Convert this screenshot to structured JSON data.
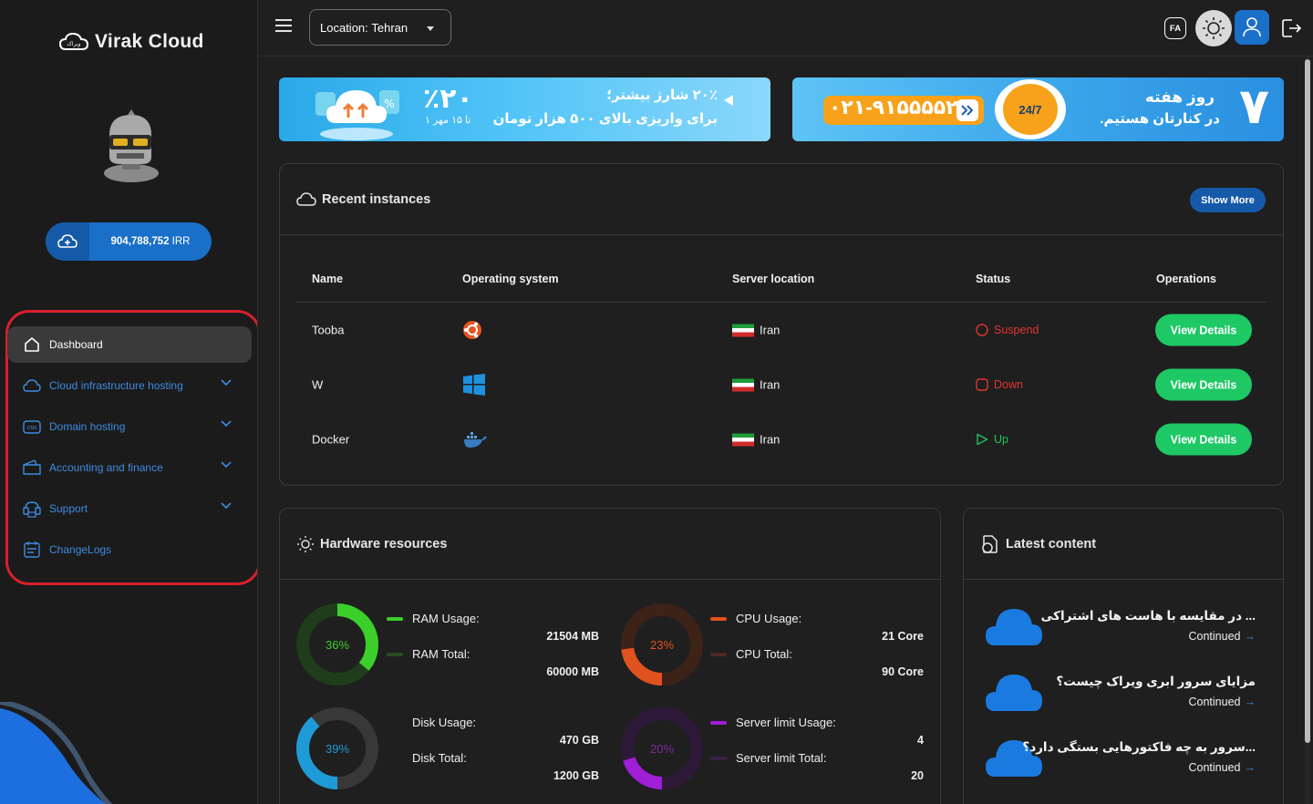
{
  "brand": {
    "name": "Virak Cloud"
  },
  "wallet": {
    "amount": "904,788,752",
    "currency": "IRR"
  },
  "sidebar": {
    "items": [
      {
        "label": "Dashboard",
        "active": true,
        "icon": "home-icon"
      },
      {
        "label": "Cloud infrastructure hosting",
        "icon": "cloud-icon"
      },
      {
        "label": "Domain hosting",
        "icon": "dns-icon"
      },
      {
        "label": "Accounting and finance",
        "icon": "wallet-icon"
      },
      {
        "label": "Support",
        "icon": "support-icon"
      },
      {
        "label": "ChangeLogs",
        "icon": "changelog-icon"
      }
    ]
  },
  "topbar": {
    "location_label": "Location:",
    "location_value": "Tehran",
    "lang": "FA"
  },
  "banners": {
    "left": {
      "percent": "٪۲۰",
      "line1": "۲۰٪ شارژ بیشتر؛",
      "line2": "برای واریزی بالای ۵۰۰ هزار تومان",
      "dates": "۱ تا ۱۵ مهر"
    },
    "right": {
      "phone": "۰۲۱-۹۱۵۵۵۵۲۰",
      "badge": "24/7",
      "line1": "روز هفته",
      "line2": "در کنارتان هستیم.",
      "digit": "۷"
    }
  },
  "recent": {
    "title": "Recent instances",
    "show_more": "Show More",
    "columns": [
      "Name",
      "Operating system",
      "Server location",
      "Status",
      "Operations"
    ],
    "rows": [
      {
        "name": "Tooba",
        "os": "ubuntu",
        "location": "Iran",
        "status": "Suspend",
        "action": "View Details"
      },
      {
        "name": "W",
        "os": "windows",
        "location": "Iran",
        "status": "Down",
        "action": "View Details"
      },
      {
        "name": "Docker",
        "os": "docker",
        "location": "Iran",
        "status": "Up",
        "action": "View Details"
      }
    ]
  },
  "hardware": {
    "title": "Hardware resources",
    "ram": {
      "percent": "36%",
      "usage_label": "RAM Usage:",
      "usage": "21504 MB",
      "total_label": "RAM Total:",
      "total": "60000 MB",
      "color": "#3ccf2a"
    },
    "cpu": {
      "percent": "23%",
      "usage_label": "CPU Usage:",
      "usage": "21 Core",
      "total_label": "CPU Total:",
      "total": "90 Core",
      "color": "#e0521f"
    },
    "disk": {
      "percent": "39%",
      "usage_label": "Disk Usage:",
      "usage": "470 GB",
      "total_label": "Disk Total:",
      "total": "1200 GB",
      "color": "#1e9bd6"
    },
    "server": {
      "percent": "20%",
      "usage_label": "Server limit Usage:",
      "usage": "4",
      "total_label": "Server limit Total:",
      "total": "20",
      "color": "#a01ed6"
    }
  },
  "latest": {
    "title": "Latest content",
    "items": [
      {
        "title": "... در مقایسه با هاست های اشتراکی",
        "more": "Continued"
      },
      {
        "title": "مزایای سرور ابری ویراک چیست؟",
        "more": "Continued"
      },
      {
        "title": "...سرور به چه فاکتورهایی بستگی دارد؟",
        "more": "Continued"
      }
    ]
  }
}
